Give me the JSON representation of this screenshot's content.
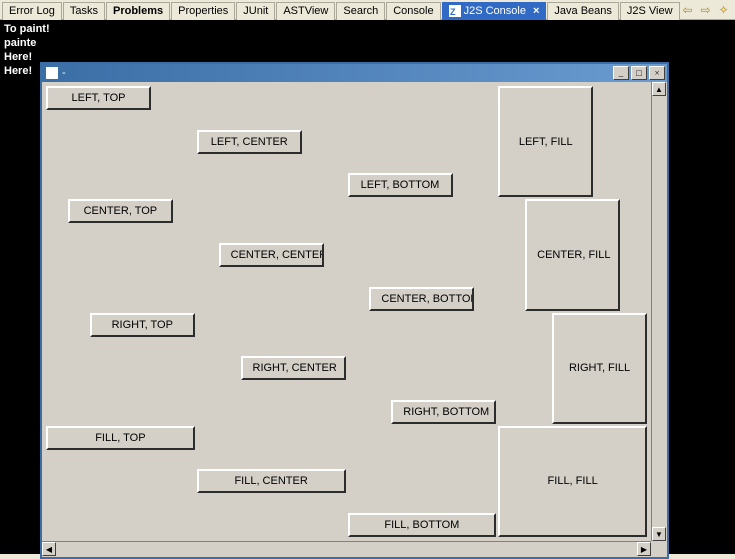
{
  "tabs": {
    "error_log": "Error Log",
    "tasks": "Tasks",
    "problems": "Problems",
    "properties": "Properties",
    "junit": "JUnit",
    "astview": "ASTView",
    "search": "Search",
    "console": "Console",
    "j2s_console": "J2S Console",
    "java_beans": "Java Beans",
    "j2s_view": "J2S View"
  },
  "console_lines": [
    "To paint!",
    "painte",
    "Here!",
    "Here!"
  ],
  "window": {
    "title": "-",
    "buttons": {
      "LEFT_TOP": "LEFT, TOP",
      "LEFT_CENTER": "LEFT, CENTER",
      "LEFT_BOTTOM": "LEFT, BOTTOM",
      "LEFT_FILL": "LEFT, FILL",
      "CENTER_TOP": "CENTER, TOP",
      "CENTER_CENTER": "CENTER, CENTER",
      "CENTER_BOTTOM": "CENTER, BOTTOM",
      "CENTER_FILL": "CENTER, FILL",
      "RIGHT_TOP": "RIGHT, TOP",
      "RIGHT_CENTER": "RIGHT, CENTER",
      "RIGHT_BOTTOM": "RIGHT, BOTTOM",
      "RIGHT_FILL": "RIGHT, FILL",
      "FILL_TOP": "FILL, TOP",
      "FILL_CENTER": "FILL, CENTER",
      "FILL_BOTTOM": "FILL, BOTTOM",
      "FILL_FILL": "FILL, FILL"
    }
  }
}
